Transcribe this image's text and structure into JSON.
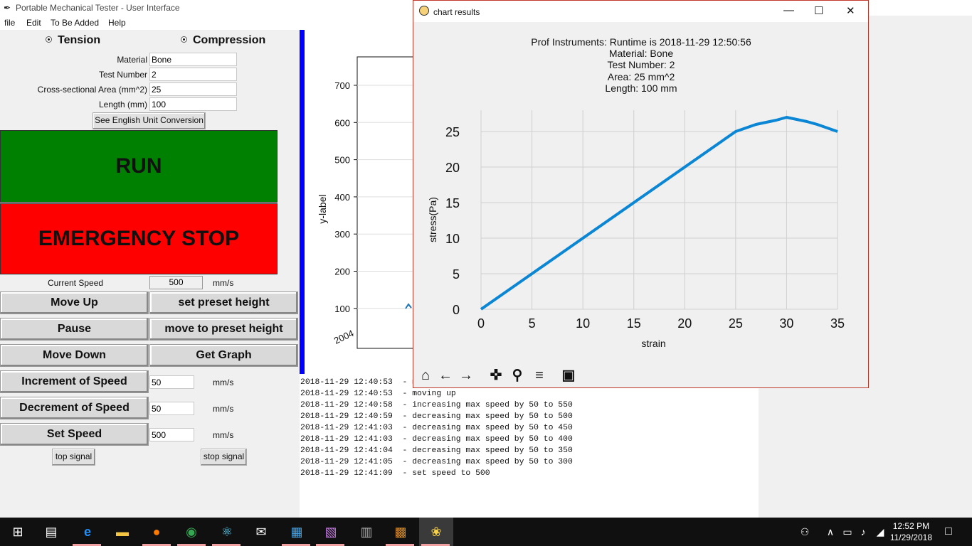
{
  "window": {
    "title": "Portable Mechanical Tester - User Interface",
    "menu": [
      "file",
      "Edit",
      "To Be Added",
      "Help"
    ]
  },
  "mode": {
    "tension": "Tension",
    "compression": "Compression",
    "selected": "Compression"
  },
  "form": {
    "material_label": "Material",
    "material_value": "Bone",
    "test_number_label": "Test Number",
    "test_number_value": "2",
    "area_label": "Cross-sectional Area (mm^2)",
    "area_value": "25",
    "length_label": "Length (mm)",
    "length_value": "100",
    "conversion_button": "See English Unit Conversion"
  },
  "run_label": "RUN",
  "stop_label": "EMERGENCY STOP",
  "speed": {
    "label": "Current Speed",
    "value": "500",
    "unit": "mm/s"
  },
  "controls": {
    "move_up": "Move Up",
    "set_preset": "set preset height",
    "pause": "Pause",
    "move_preset": "move to preset height",
    "move_down": "Move Down",
    "get_graph": "Get Graph",
    "increment": "Increment of Speed",
    "increment_value": "50",
    "decrement": "Decrement of Speed",
    "decrement_value": "50",
    "set_speed": "Set Speed",
    "set_speed_value": "500",
    "unit": "mm/s",
    "top_signal": "top signal",
    "stop_signal": "stop signal"
  },
  "bg_chart": {
    "ylabel": "y-label",
    "yticks": [
      "700",
      "600",
      "500",
      "400",
      "300",
      "200",
      "100"
    ],
    "xtick": "2004"
  },
  "log": [
    "2018-11-29 12:40:53  - moving up",
    "2018-11-29 12:40:53  - moving up",
    "2018-11-29 12:40:58  - increasing max speed by 50 to 550",
    "2018-11-29 12:40:59  - decreasing max speed by 50 to 500",
    "2018-11-29 12:41:03  - decreasing max speed by 50 to 450",
    "2018-11-29 12:41:03  - decreasing max speed by 50 to 400",
    "2018-11-29 12:41:04  - decreasing max speed by 50 to 350",
    "2018-11-29 12:41:05  - decreasing max speed by 50 to 300",
    "2018-11-29 12:41:09  - set speed to 500"
  ],
  "chart_window": {
    "title": "chart results",
    "lines": [
      "Prof Instruments: Runtime is 2018-11-29 12:50:56",
      "Material: Bone",
      "Test Number: 2",
      "Area: 25 mm^2",
      "Length: 100 mm"
    ]
  },
  "chart_data": {
    "type": "line",
    "xlabel": "strain",
    "ylabel": "stress(Pa)",
    "xlim": [
      0,
      35
    ],
    "ylim": [
      0,
      28
    ],
    "xticks": [
      0,
      5,
      10,
      15,
      20,
      25,
      30,
      35
    ],
    "yticks": [
      0,
      5,
      10,
      15,
      20,
      25
    ],
    "grid": true,
    "color": "#0a86d4",
    "x": [
      0,
      5,
      10,
      15,
      20,
      25,
      27,
      29,
      30,
      32,
      33,
      35
    ],
    "y": [
      0,
      5,
      10,
      15,
      20,
      25,
      26,
      26.6,
      27,
      26.4,
      26,
      25
    ]
  },
  "taskbar": {
    "time": "12:52 PM",
    "date": "11/29/2018"
  }
}
